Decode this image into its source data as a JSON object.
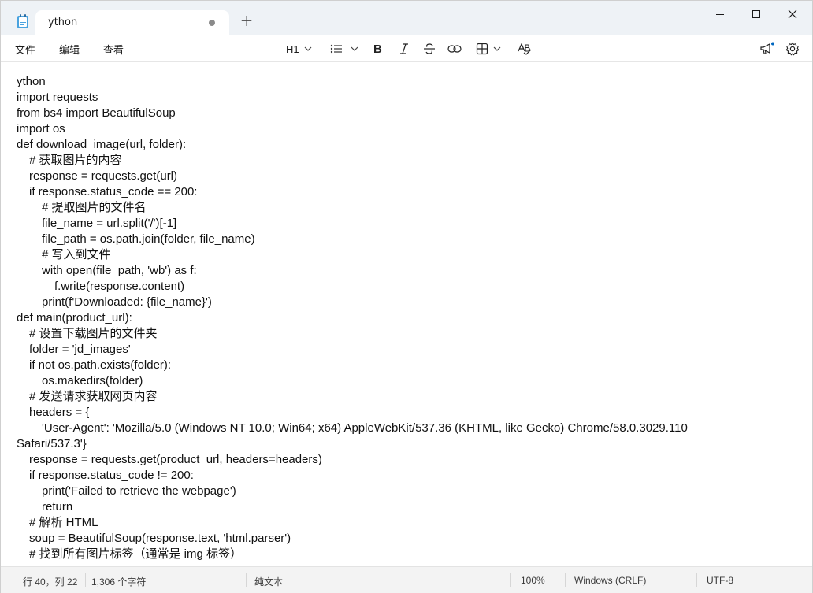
{
  "tab": {
    "title": "ython",
    "new_tab_icon": "plus-icon"
  },
  "window_controls": [
    "minimize-icon",
    "maximize-icon",
    "close-icon"
  ],
  "menu": [
    "文件",
    "编辑",
    "查看"
  ],
  "toolbar": {
    "heading_label": "H1"
  },
  "editor": {
    "lines": [
      "ython",
      "import requests",
      "from bs4 import BeautifulSoup",
      "import os",
      "def download_image(url, folder):",
      "# 获取图片的内容",
      "response = requests.get(url)",
      "if response.status_code == 200:",
      "# 提取图片的文件名",
      "file_name = url.split('/')[-1]",
      "file_path = os.path.join(folder, file_name)",
      "# 写入到文件",
      "with open(file_path, 'wb') as f:",
      "f.write(response.content)",
      "print(f'Downloaded: {file_name}')",
      "def main(product_url):",
      "# 设置下载图片的文件夹",
      "folder = 'jd_images'",
      "if not os.path.exists(folder):",
      "os.makedirs(folder)",
      "# 发送请求获取网页内容",
      "headers = {",
      "'User-Agent': 'Mozilla/5.0 (Windows NT 10.0; Win64; x64) AppleWebKit/537.36 (KHTML, like Gecko) Chrome/58.0.3029.110",
      "Safari/537.3'}",
      "response = requests.get(product_url, headers=headers)",
      "if response.status_code != 200:",
      "print('Failed to retrieve the webpage')",
      "return",
      "# 解析 HTML",
      "soup = BeautifulSoup(response.text, 'html.parser')",
      "# 找到所有图片标签（通常是 img 标签）"
    ]
  },
  "status": {
    "position": "行 40，列 22",
    "char_count": "1,306 个字符",
    "format": "纯文本",
    "zoom": "100%",
    "line_ending": "Windows (CRLF)",
    "encoding": "UTF-8"
  }
}
